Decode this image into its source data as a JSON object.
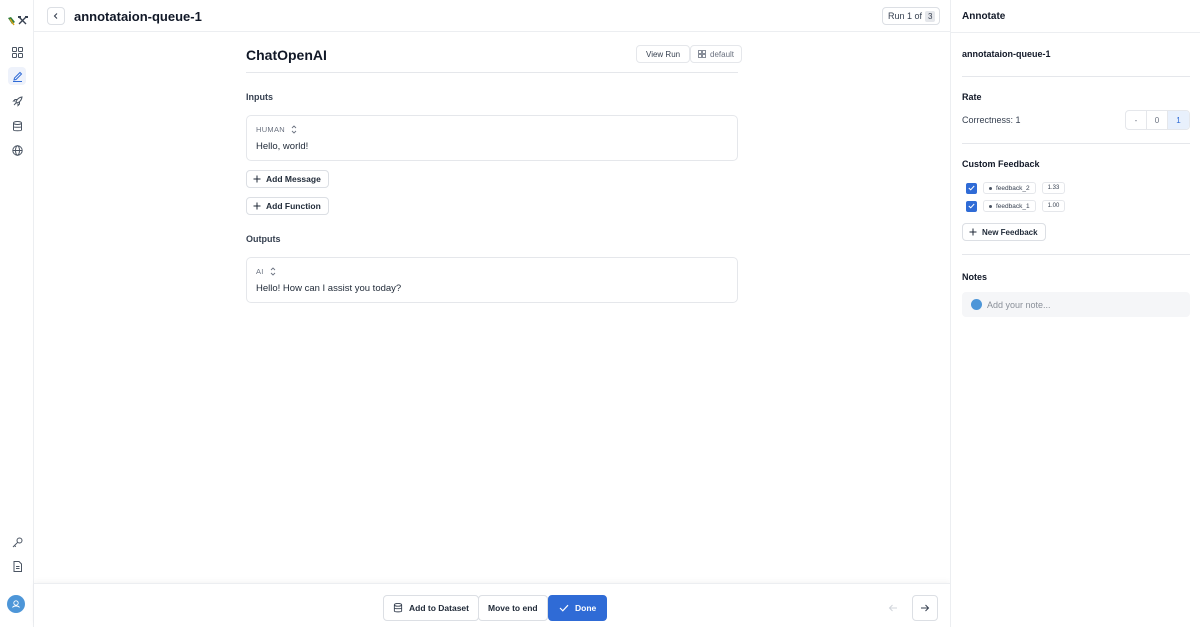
{
  "header": {
    "queue_title": "annotataion-queue-1",
    "run_label": "Run 1 of",
    "run_total": "3"
  },
  "run": {
    "title": "ChatOpenAI",
    "view_run_label": "View Run",
    "project_tag": "default"
  },
  "inputs": {
    "label": "Inputs",
    "messages": [
      {
        "role": "HUMAN",
        "text": "Hello, world!"
      }
    ],
    "add_message_label": "Add Message",
    "add_function_label": "Add Function"
  },
  "outputs": {
    "label": "Outputs",
    "messages": [
      {
        "role": "AI",
        "text": "Hello! How can I assist you today?"
      }
    ]
  },
  "bottom_bar": {
    "add_to_dataset_label": "Add to Dataset",
    "move_to_end_label": "Move to end",
    "done_label": "Done"
  },
  "annotate_panel": {
    "title": "Annotate",
    "queue_name": "annotataion-queue-1",
    "rate": {
      "label": "Rate",
      "criterion_label": "Correctness:",
      "criterion_value": "1",
      "options": [
        "-",
        "0",
        "1"
      ],
      "selected_option": "1"
    },
    "custom_feedback": {
      "label": "Custom Feedback",
      "items": [
        {
          "key": "feedback_2",
          "value": "1.33",
          "checked": true
        },
        {
          "key": "feedback_1",
          "value": "1.00",
          "checked": true
        }
      ],
      "new_feedback_label": "New Feedback"
    },
    "notes": {
      "label": "Notes",
      "placeholder": "Add your note..."
    }
  },
  "colors": {
    "accent": "#2f6bd6",
    "avatar": "#4d96d8",
    "border": "#e5e7eb"
  },
  "icons": {
    "rail": [
      "logo-icon",
      "grid-icon",
      "pencil-icon",
      "rocket-icon",
      "database-icon",
      "globe-icon",
      "key-icon",
      "document-icon",
      "user-avatar-icon"
    ]
  }
}
